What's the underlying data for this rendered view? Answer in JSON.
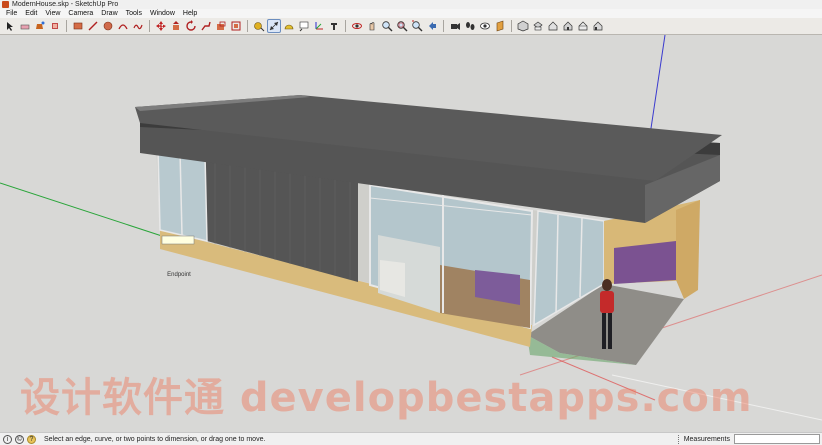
{
  "window": {
    "title": "ModernHouse.skp - SketchUp Pro"
  },
  "menu": [
    "File",
    "Edit",
    "View",
    "Camera",
    "Draw",
    "Tools",
    "Window",
    "Help"
  ],
  "toolbar": {
    "groups": [
      [
        "select-icon",
        "eraser-icon",
        "paint-bucket-icon",
        "make-component-icon"
      ],
      [
        "rectangle-icon",
        "line-icon",
        "circle-icon",
        "arc-icon",
        "freehand-icon"
      ],
      [
        "move-icon",
        "push-pull-icon",
        "rotate-icon",
        "follow-me-icon",
        "scale-icon",
        "offset-icon"
      ],
      [
        "tape-measure-icon",
        "dimension-icon",
        "protractor-icon",
        "text-icon",
        "axes-icon",
        "3d-text-icon"
      ],
      [
        "orbit-icon",
        "pan-icon",
        "zoom-icon",
        "zoom-window-icon",
        "zoom-extents-icon",
        "previous-view-icon"
      ],
      [
        "position-camera-icon",
        "walk-icon",
        "look-around-icon",
        "section-plane-icon"
      ],
      [
        "iso-view-icon",
        "top-view-icon",
        "front-view-icon",
        "right-view-icon",
        "back-view-icon",
        "left-view-icon"
      ]
    ],
    "active_tool": "dimension-icon"
  },
  "viewport": {
    "dimension_tag": "Endpoint",
    "watermark": "设计软件通 developbestapps.com"
  },
  "status": {
    "help_text": "Select an edge, curve, or two points to dimension, or drag one to move.",
    "measurements_label": "Measurements",
    "measurements_value": ""
  },
  "colors": {
    "sky": "#d8d8d6",
    "roof": "#585858",
    "brick": "#d8b878",
    "glass": "#b9ccd2",
    "person_shirt": "#c02828"
  }
}
